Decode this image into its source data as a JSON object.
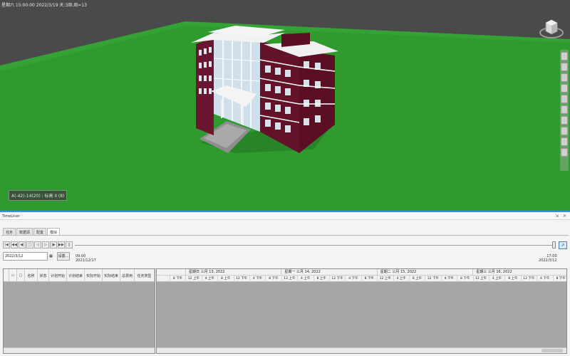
{
  "viewport": {
    "status_text": "星期六 15:00:00 2022/3/19 天:3周:周=13",
    "coord_readout": "A(-42)-14(20) : 标高 II (8)"
  },
  "timeliner": {
    "title": "TimeLiner",
    "header_buttons": "⇲ ✕",
    "tabs": [
      {
        "label": "任务",
        "active": false
      },
      {
        "label": "数据源",
        "active": false
      },
      {
        "label": "配置",
        "active": false
      },
      {
        "label": "模拟",
        "active": true
      }
    ],
    "playback": {
      "buttons": [
        "|◀",
        "◀◀",
        "◀|",
        "□",
        "◁",
        "▷",
        "|▶",
        "▶▶",
        "||"
      ],
      "export_icon": "⇗"
    },
    "date_value": "2022/3/12",
    "calendar_icon": "▦",
    "settings_label": "设置...",
    "time_start": {
      "time": "09:00",
      "date": "2021/12/17"
    },
    "time_end": {
      "time": "17:00",
      "date": "2022/3/12"
    },
    "task_columns": [
      "",
      "",
      "名称",
      "状态",
      "计划开始",
      "计划结束",
      "实际开始",
      "实际结束",
      "总费用",
      "任务类型"
    ],
    "gantt_days": [
      "星期日 三月 13, 2022",
      "星期一 三月 14, 2022",
      "星期二 三月 15, 2022",
      "星期三 三月 16, 2022"
    ],
    "gantt_hours": [
      "8 下午",
      "12 上午",
      "4 上午",
      "8 上午",
      "12 下午",
      "4 下午",
      "8 下午",
      "12 上午",
      "4 上午",
      "8 上午",
      "12 下午",
      "4 下午",
      "8 下午",
      "12 上午",
      "4 上午",
      "8 上午",
      "12 下午",
      "4 下午",
      "8 下午",
      "12 上午",
      "4 上午",
      "8 上午",
      "12 下午",
      "4 下午",
      "8 下午"
    ]
  }
}
